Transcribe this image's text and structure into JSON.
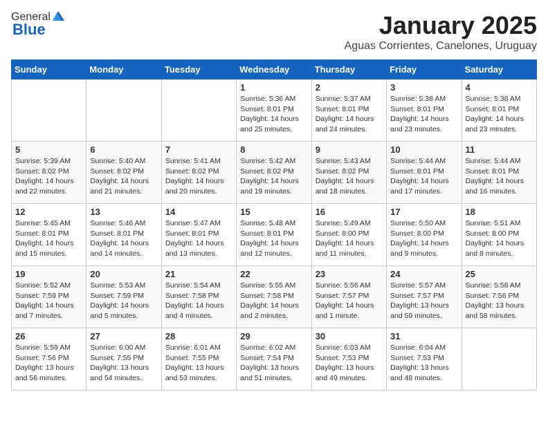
{
  "header": {
    "logo_general": "General",
    "logo_blue": "Blue",
    "month_title": "January 2025",
    "subtitle": "Aguas Corrientes, Canelones, Uruguay"
  },
  "weekdays": [
    "Sunday",
    "Monday",
    "Tuesday",
    "Wednesday",
    "Thursday",
    "Friday",
    "Saturday"
  ],
  "weeks": [
    [
      {
        "day": "",
        "info": ""
      },
      {
        "day": "",
        "info": ""
      },
      {
        "day": "",
        "info": ""
      },
      {
        "day": "1",
        "info": "Sunrise: 5:36 AM\nSunset: 8:01 PM\nDaylight: 14 hours\nand 25 minutes."
      },
      {
        "day": "2",
        "info": "Sunrise: 5:37 AM\nSunset: 8:01 PM\nDaylight: 14 hours\nand 24 minutes."
      },
      {
        "day": "3",
        "info": "Sunrise: 5:38 AM\nSunset: 8:01 PM\nDaylight: 14 hours\nand 23 minutes."
      },
      {
        "day": "4",
        "info": "Sunrise: 5:38 AM\nSunset: 8:01 PM\nDaylight: 14 hours\nand 23 minutes."
      }
    ],
    [
      {
        "day": "5",
        "info": "Sunrise: 5:39 AM\nSunset: 8:02 PM\nDaylight: 14 hours\nand 22 minutes."
      },
      {
        "day": "6",
        "info": "Sunrise: 5:40 AM\nSunset: 8:02 PM\nDaylight: 14 hours\nand 21 minutes."
      },
      {
        "day": "7",
        "info": "Sunrise: 5:41 AM\nSunset: 8:02 PM\nDaylight: 14 hours\nand 20 minutes."
      },
      {
        "day": "8",
        "info": "Sunrise: 5:42 AM\nSunset: 8:02 PM\nDaylight: 14 hours\nand 19 minutes."
      },
      {
        "day": "9",
        "info": "Sunrise: 5:43 AM\nSunset: 8:02 PM\nDaylight: 14 hours\nand 18 minutes."
      },
      {
        "day": "10",
        "info": "Sunrise: 5:44 AM\nSunset: 8:01 PM\nDaylight: 14 hours\nand 17 minutes."
      },
      {
        "day": "11",
        "info": "Sunrise: 5:44 AM\nSunset: 8:01 PM\nDaylight: 14 hours\nand 16 minutes."
      }
    ],
    [
      {
        "day": "12",
        "info": "Sunrise: 5:45 AM\nSunset: 8:01 PM\nDaylight: 14 hours\nand 15 minutes."
      },
      {
        "day": "13",
        "info": "Sunrise: 5:46 AM\nSunset: 8:01 PM\nDaylight: 14 hours\nand 14 minutes."
      },
      {
        "day": "14",
        "info": "Sunrise: 5:47 AM\nSunset: 8:01 PM\nDaylight: 14 hours\nand 13 minutes."
      },
      {
        "day": "15",
        "info": "Sunrise: 5:48 AM\nSunset: 8:01 PM\nDaylight: 14 hours\nand 12 minutes."
      },
      {
        "day": "16",
        "info": "Sunrise: 5:49 AM\nSunset: 8:00 PM\nDaylight: 14 hours\nand 11 minutes."
      },
      {
        "day": "17",
        "info": "Sunrise: 5:50 AM\nSunset: 8:00 PM\nDaylight: 14 hours\nand 9 minutes."
      },
      {
        "day": "18",
        "info": "Sunrise: 5:51 AM\nSunset: 8:00 PM\nDaylight: 14 hours\nand 8 minutes."
      }
    ],
    [
      {
        "day": "19",
        "info": "Sunrise: 5:52 AM\nSunset: 7:59 PM\nDaylight: 14 hours\nand 7 minutes."
      },
      {
        "day": "20",
        "info": "Sunrise: 5:53 AM\nSunset: 7:59 PM\nDaylight: 14 hours\nand 5 minutes."
      },
      {
        "day": "21",
        "info": "Sunrise: 5:54 AM\nSunset: 7:58 PM\nDaylight: 14 hours\nand 4 minutes."
      },
      {
        "day": "22",
        "info": "Sunrise: 5:55 AM\nSunset: 7:58 PM\nDaylight: 14 hours\nand 2 minutes."
      },
      {
        "day": "23",
        "info": "Sunrise: 5:56 AM\nSunset: 7:57 PM\nDaylight: 14 hours\nand 1 minute."
      },
      {
        "day": "24",
        "info": "Sunrise: 5:57 AM\nSunset: 7:57 PM\nDaylight: 13 hours\nand 59 minutes."
      },
      {
        "day": "25",
        "info": "Sunrise: 5:58 AM\nSunset: 7:56 PM\nDaylight: 13 hours\nand 58 minutes."
      }
    ],
    [
      {
        "day": "26",
        "info": "Sunrise: 5:59 AM\nSunset: 7:56 PM\nDaylight: 13 hours\nand 56 minutes."
      },
      {
        "day": "27",
        "info": "Sunrise: 6:00 AM\nSunset: 7:55 PM\nDaylight: 13 hours\nand 54 minutes."
      },
      {
        "day": "28",
        "info": "Sunrise: 6:01 AM\nSunset: 7:55 PM\nDaylight: 13 hours\nand 53 minutes."
      },
      {
        "day": "29",
        "info": "Sunrise: 6:02 AM\nSunset: 7:54 PM\nDaylight: 13 hours\nand 51 minutes."
      },
      {
        "day": "30",
        "info": "Sunrise: 6:03 AM\nSunset: 7:53 PM\nDaylight: 13 hours\nand 49 minutes."
      },
      {
        "day": "31",
        "info": "Sunrise: 6:04 AM\nSunset: 7:53 PM\nDaylight: 13 hours\nand 48 minutes."
      },
      {
        "day": "",
        "info": ""
      }
    ]
  ]
}
